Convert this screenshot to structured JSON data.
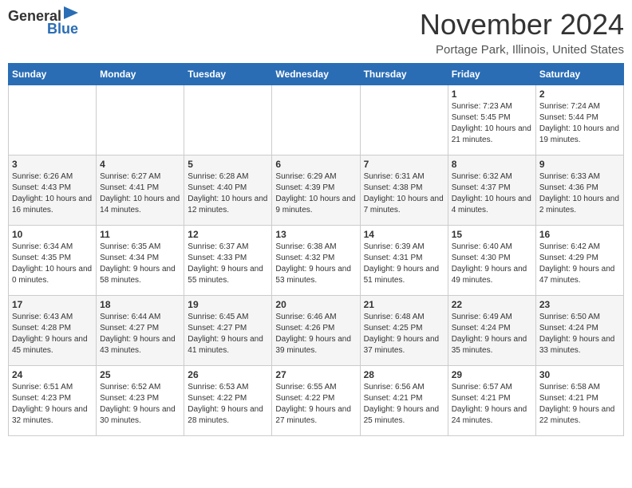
{
  "logo": {
    "general": "General",
    "blue": "Blue"
  },
  "title": "November 2024",
  "location": "Portage Park, Illinois, United States",
  "days_header": [
    "Sunday",
    "Monday",
    "Tuesday",
    "Wednesday",
    "Thursday",
    "Friday",
    "Saturday"
  ],
  "weeks": [
    [
      {
        "day": "",
        "info": ""
      },
      {
        "day": "",
        "info": ""
      },
      {
        "day": "",
        "info": ""
      },
      {
        "day": "",
        "info": ""
      },
      {
        "day": "",
        "info": ""
      },
      {
        "day": "1",
        "info": "Sunrise: 7:23 AM\nSunset: 5:45 PM\nDaylight: 10 hours and 21 minutes."
      },
      {
        "day": "2",
        "info": "Sunrise: 7:24 AM\nSunset: 5:44 PM\nDaylight: 10 hours and 19 minutes."
      }
    ],
    [
      {
        "day": "3",
        "info": "Sunrise: 6:26 AM\nSunset: 4:43 PM\nDaylight: 10 hours and 16 minutes."
      },
      {
        "day": "4",
        "info": "Sunrise: 6:27 AM\nSunset: 4:41 PM\nDaylight: 10 hours and 14 minutes."
      },
      {
        "day": "5",
        "info": "Sunrise: 6:28 AM\nSunset: 4:40 PM\nDaylight: 10 hours and 12 minutes."
      },
      {
        "day": "6",
        "info": "Sunrise: 6:29 AM\nSunset: 4:39 PM\nDaylight: 10 hours and 9 minutes."
      },
      {
        "day": "7",
        "info": "Sunrise: 6:31 AM\nSunset: 4:38 PM\nDaylight: 10 hours and 7 minutes."
      },
      {
        "day": "8",
        "info": "Sunrise: 6:32 AM\nSunset: 4:37 PM\nDaylight: 10 hours and 4 minutes."
      },
      {
        "day": "9",
        "info": "Sunrise: 6:33 AM\nSunset: 4:36 PM\nDaylight: 10 hours and 2 minutes."
      }
    ],
    [
      {
        "day": "10",
        "info": "Sunrise: 6:34 AM\nSunset: 4:35 PM\nDaylight: 10 hours and 0 minutes."
      },
      {
        "day": "11",
        "info": "Sunrise: 6:35 AM\nSunset: 4:34 PM\nDaylight: 9 hours and 58 minutes."
      },
      {
        "day": "12",
        "info": "Sunrise: 6:37 AM\nSunset: 4:33 PM\nDaylight: 9 hours and 55 minutes."
      },
      {
        "day": "13",
        "info": "Sunrise: 6:38 AM\nSunset: 4:32 PM\nDaylight: 9 hours and 53 minutes."
      },
      {
        "day": "14",
        "info": "Sunrise: 6:39 AM\nSunset: 4:31 PM\nDaylight: 9 hours and 51 minutes."
      },
      {
        "day": "15",
        "info": "Sunrise: 6:40 AM\nSunset: 4:30 PM\nDaylight: 9 hours and 49 minutes."
      },
      {
        "day": "16",
        "info": "Sunrise: 6:42 AM\nSunset: 4:29 PM\nDaylight: 9 hours and 47 minutes."
      }
    ],
    [
      {
        "day": "17",
        "info": "Sunrise: 6:43 AM\nSunset: 4:28 PM\nDaylight: 9 hours and 45 minutes."
      },
      {
        "day": "18",
        "info": "Sunrise: 6:44 AM\nSunset: 4:27 PM\nDaylight: 9 hours and 43 minutes."
      },
      {
        "day": "19",
        "info": "Sunrise: 6:45 AM\nSunset: 4:27 PM\nDaylight: 9 hours and 41 minutes."
      },
      {
        "day": "20",
        "info": "Sunrise: 6:46 AM\nSunset: 4:26 PM\nDaylight: 9 hours and 39 minutes."
      },
      {
        "day": "21",
        "info": "Sunrise: 6:48 AM\nSunset: 4:25 PM\nDaylight: 9 hours and 37 minutes."
      },
      {
        "day": "22",
        "info": "Sunrise: 6:49 AM\nSunset: 4:24 PM\nDaylight: 9 hours and 35 minutes."
      },
      {
        "day": "23",
        "info": "Sunrise: 6:50 AM\nSunset: 4:24 PM\nDaylight: 9 hours and 33 minutes."
      }
    ],
    [
      {
        "day": "24",
        "info": "Sunrise: 6:51 AM\nSunset: 4:23 PM\nDaylight: 9 hours and 32 minutes."
      },
      {
        "day": "25",
        "info": "Sunrise: 6:52 AM\nSunset: 4:23 PM\nDaylight: 9 hours and 30 minutes."
      },
      {
        "day": "26",
        "info": "Sunrise: 6:53 AM\nSunset: 4:22 PM\nDaylight: 9 hours and 28 minutes."
      },
      {
        "day": "27",
        "info": "Sunrise: 6:55 AM\nSunset: 4:22 PM\nDaylight: 9 hours and 27 minutes."
      },
      {
        "day": "28",
        "info": "Sunrise: 6:56 AM\nSunset: 4:21 PM\nDaylight: 9 hours and 25 minutes."
      },
      {
        "day": "29",
        "info": "Sunrise: 6:57 AM\nSunset: 4:21 PM\nDaylight: 9 hours and 24 minutes."
      },
      {
        "day": "30",
        "info": "Sunrise: 6:58 AM\nSunset: 4:21 PM\nDaylight: 9 hours and 22 minutes."
      }
    ]
  ]
}
